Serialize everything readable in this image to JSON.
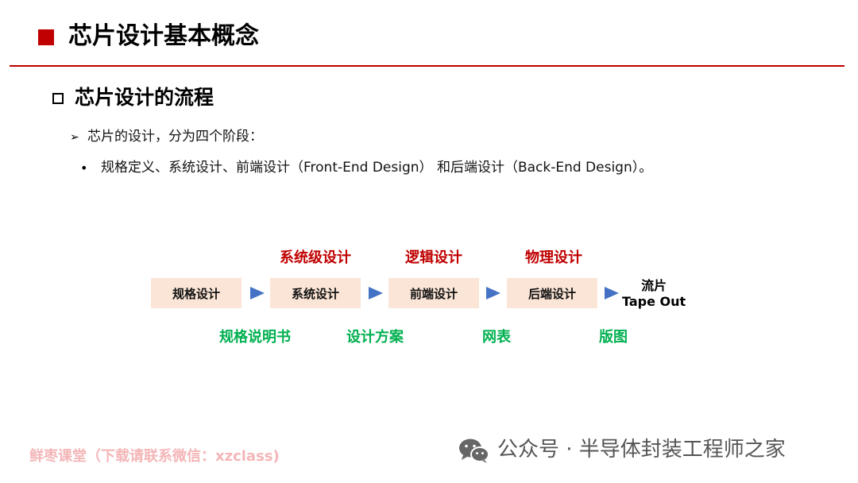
{
  "header": {
    "title": "芯片设计基本概念",
    "accent_color": "#c00000"
  },
  "section": {
    "title": "芯片设计的流程"
  },
  "bullets": {
    "arrow_glyph": "➢",
    "line1": "芯片的设计，分为四个阶段：",
    "dot_glyph": "•",
    "line2": "规格定义、系统设计、前端设计（Front-End Design） 和后端设计（Back-End Design）。"
  },
  "flow": {
    "stages": [
      "规格设计",
      "系统设计",
      "前端设计",
      "后端设计"
    ],
    "top_labels": [
      "系统级设计",
      "逻辑设计",
      "物理设计"
    ],
    "bottom_labels": [
      "规格说明书",
      "设计方案",
      "网表",
      "版图"
    ],
    "final": {
      "line1": "流片",
      "line2": "Tape Out"
    },
    "box_color": "#fbe5d6",
    "arrow_color": "#4472c4",
    "top_label_color": "#c00000",
    "bottom_label_color": "#00b050"
  },
  "footer": {
    "left_text": "鲜枣课堂（下载请联系微信：xzclass)",
    "icon": "wechat-icon",
    "right_text": "公众号 · 半导体封装工程师之家"
  }
}
